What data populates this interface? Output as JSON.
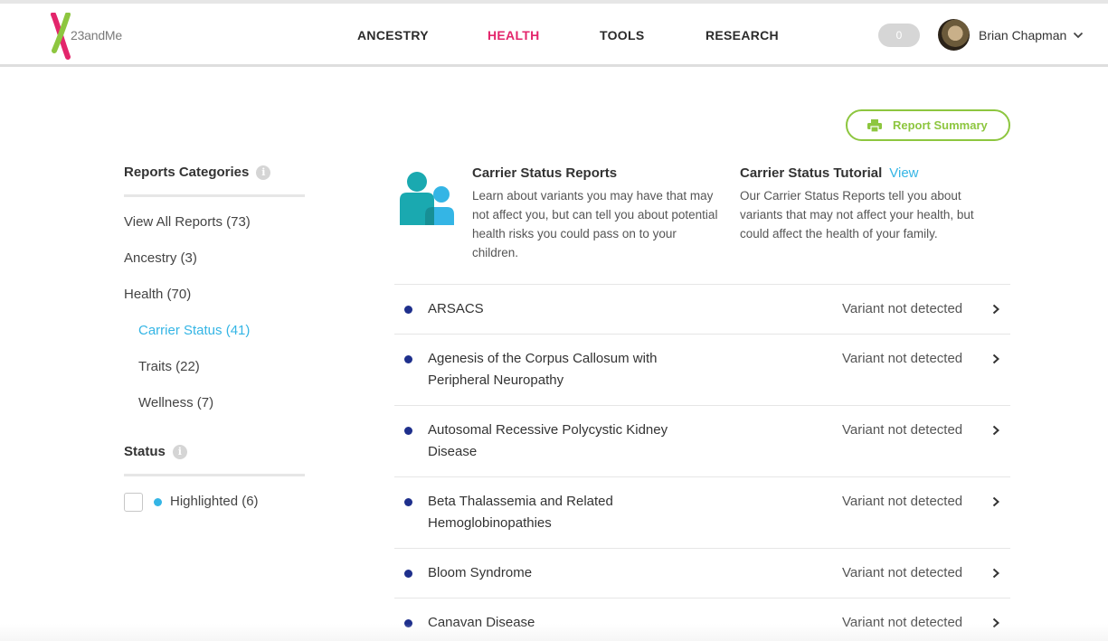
{
  "header": {
    "logo_text": "23andMe",
    "nav": [
      {
        "label": "ANCESTRY",
        "active": false
      },
      {
        "label": "HEALTH",
        "active": true
      },
      {
        "label": "TOOLS",
        "active": false
      },
      {
        "label": "RESEARCH",
        "active": false
      }
    ],
    "notification_count": "0",
    "user_name": "Brian Chapman"
  },
  "sidebar": {
    "categories_title": "Reports Categories",
    "categories": [
      {
        "label": "View All Reports (73)",
        "active": false,
        "indent": false
      },
      {
        "label": "Ancestry (3)",
        "active": false,
        "indent": false
      },
      {
        "label": "Health (70)",
        "active": false,
        "indent": false
      },
      {
        "label": "Carrier Status (41)",
        "active": true,
        "indent": true
      },
      {
        "label": "Traits (22)",
        "active": false,
        "indent": true
      },
      {
        "label": "Wellness (7)",
        "active": false,
        "indent": true
      }
    ],
    "status_title": "Status",
    "status_filter": {
      "label": "Highlighted (6)",
      "checked": false
    }
  },
  "report_summary_label": "Report Summary",
  "info": {
    "reports_title": "Carrier Status Reports",
    "reports_body": "Learn about variants you may have that may not affect you, but can tell you about potential health risks you could pass on to your children.",
    "tutorial_title": "Carrier Status Tutorial",
    "tutorial_link": "View",
    "tutorial_body": "Our Carrier Status Reports tell you about variants that may not affect your health, but could affect the health of your family."
  },
  "reports": [
    {
      "name": "ARSACS",
      "status": "Variant not detected"
    },
    {
      "name": "Agenesis of the Corpus Callosum with Peripheral Neuropathy",
      "status": "Variant not detected"
    },
    {
      "name": "Autosomal Recessive Polycystic Kidney Disease",
      "status": "Variant not detected"
    },
    {
      "name": "Beta Thalassemia and Related Hemoglobinopathies",
      "status": "Variant not detected"
    },
    {
      "name": "Bloom Syndrome",
      "status": "Variant not detected"
    },
    {
      "name": "Canavan Disease",
      "status": "Variant not detected"
    }
  ],
  "colors": {
    "brand_pink": "#e3256b",
    "accent_blue": "#34b5e5",
    "accent_green": "#8dc63f",
    "bullet_navy": "#1e2f8c"
  }
}
